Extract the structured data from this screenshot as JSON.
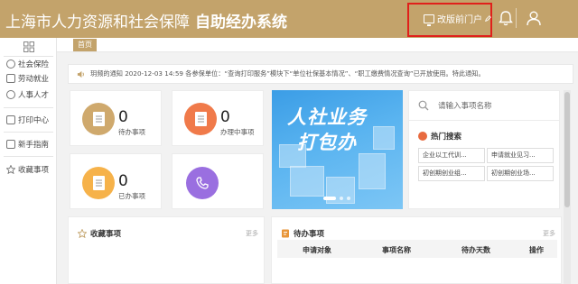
{
  "header": {
    "title": "上海市人力资源和社会保障",
    "subtitle": "自助经办系统",
    "portal_link": "改版前门户",
    "icons": [
      "monitor-icon",
      "bell-icon",
      "user-icon"
    ],
    "accent_color": "#c3a36b",
    "highlight_color": "#e0201b"
  },
  "sidebar": {
    "items": [
      {
        "label": "社会保险",
        "icon": "shield-icon"
      },
      {
        "label": "劳动就业",
        "icon": "briefcase-icon"
      },
      {
        "label": "人事人才",
        "icon": "person-icon"
      },
      {
        "label": "打印中心",
        "icon": "printer-icon"
      },
      {
        "label": "新手指南",
        "icon": "guide-icon"
      },
      {
        "label": "收藏事项",
        "icon": "star-icon"
      }
    ]
  },
  "tabs": {
    "home": "首页"
  },
  "notice": {
    "text": "玥频的通知 2020-12-03 14:59 各参保单位：“查询打印服务”模块下“单位社保基本情况”、“职工缴费情况查询”已开放使用。特此通知。"
  },
  "stats": [
    {
      "value": "0",
      "label": "待办事项",
      "color": "#cfa96d"
    },
    {
      "value": "0",
      "label": "办理中事项",
      "color": "#f07a4a"
    },
    {
      "value": "0",
      "label": "已办事项",
      "color": "#f6b24a"
    },
    {
      "value": "",
      "label": "",
      "color": "#9a6fe0"
    }
  ],
  "banner": {
    "line1": "人社业务",
    "line2": "打包办"
  },
  "search": {
    "placeholder": "请输入事项名称",
    "hot_title": "热门搜索",
    "chips": [
      "企业以工代训...",
      "申请就业见习...",
      "初创期创业组...",
      "初创期创业场..."
    ]
  },
  "favorites": {
    "title": "收藏事项",
    "more": "更多"
  },
  "todo": {
    "title": "待办事项",
    "more": "更多",
    "columns": [
      "申请对象",
      "事项名称",
      "待办天数",
      "操作"
    ]
  }
}
